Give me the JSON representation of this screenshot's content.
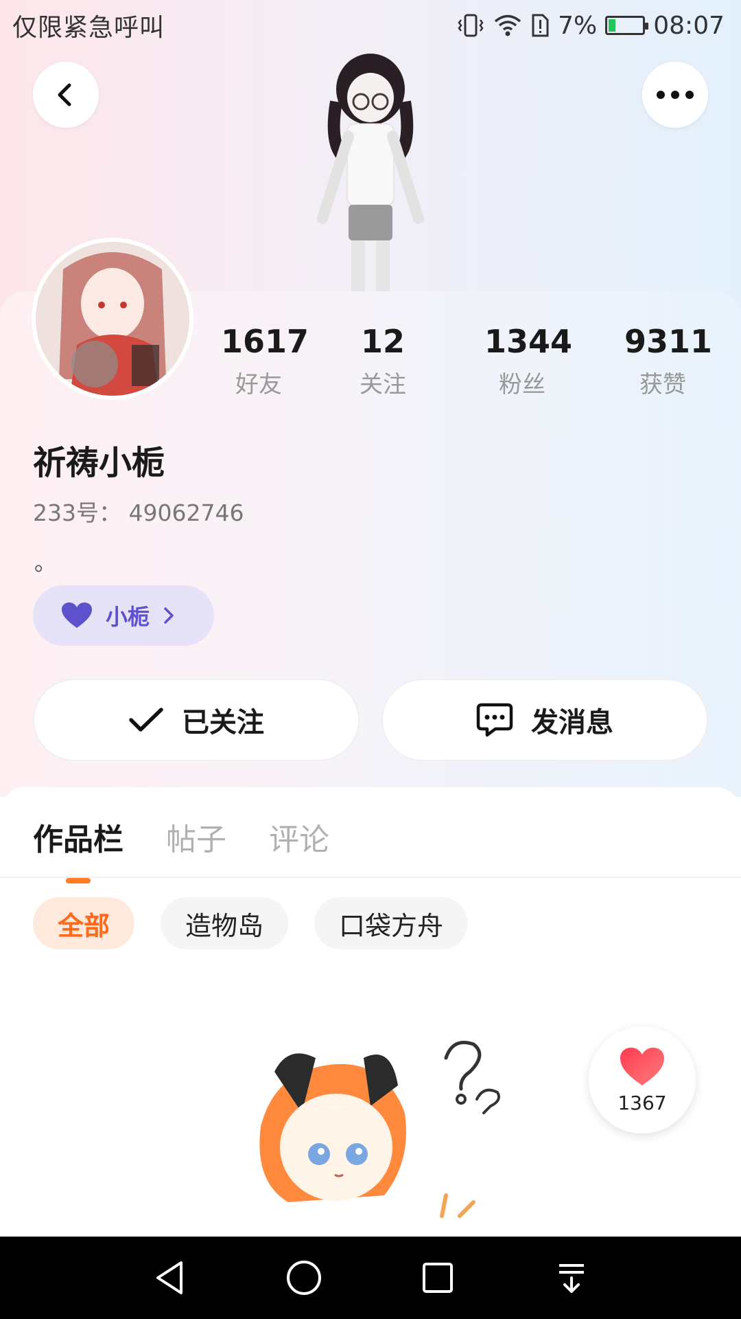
{
  "status_bar": {
    "carrier_text": "仅限紧急呼叫",
    "battery_percent": "7%",
    "time": "08:07"
  },
  "profile": {
    "stats": [
      {
        "value": "1617",
        "label": "好友"
      },
      {
        "value": "12",
        "label": "关注"
      },
      {
        "value": "1344",
        "label": "粉丝"
      },
      {
        "value": "9311",
        "label": "获赞"
      }
    ],
    "nickname": "祈祷小栀",
    "uid_label": "233号：",
    "uid_value": "49062746",
    "bio": "。",
    "heart_tag_label": "小栀"
  },
  "actions": {
    "follow_label": "已关注",
    "message_label": "发消息"
  },
  "tabs": [
    {
      "label": "作品栏",
      "active": true
    },
    {
      "label": "帖子",
      "active": false
    },
    {
      "label": "评论",
      "active": false
    }
  ],
  "filter_chips": [
    {
      "label": "全部",
      "active": true
    },
    {
      "label": "造物岛",
      "active": false
    },
    {
      "label": "口袋方舟",
      "active": false
    }
  ],
  "like_fab": {
    "count": "1367"
  },
  "colors": {
    "accent": "#ff7d26",
    "heart_tag_text": "#5e52cc",
    "heart_tag_bg": "#e6e2f8"
  },
  "icons": {
    "back": "chevron-left-icon",
    "more": "more-dots-icon",
    "follow": "checkmark-icon",
    "message": "chat-bubble-icon",
    "heart": "heart-icon"
  }
}
